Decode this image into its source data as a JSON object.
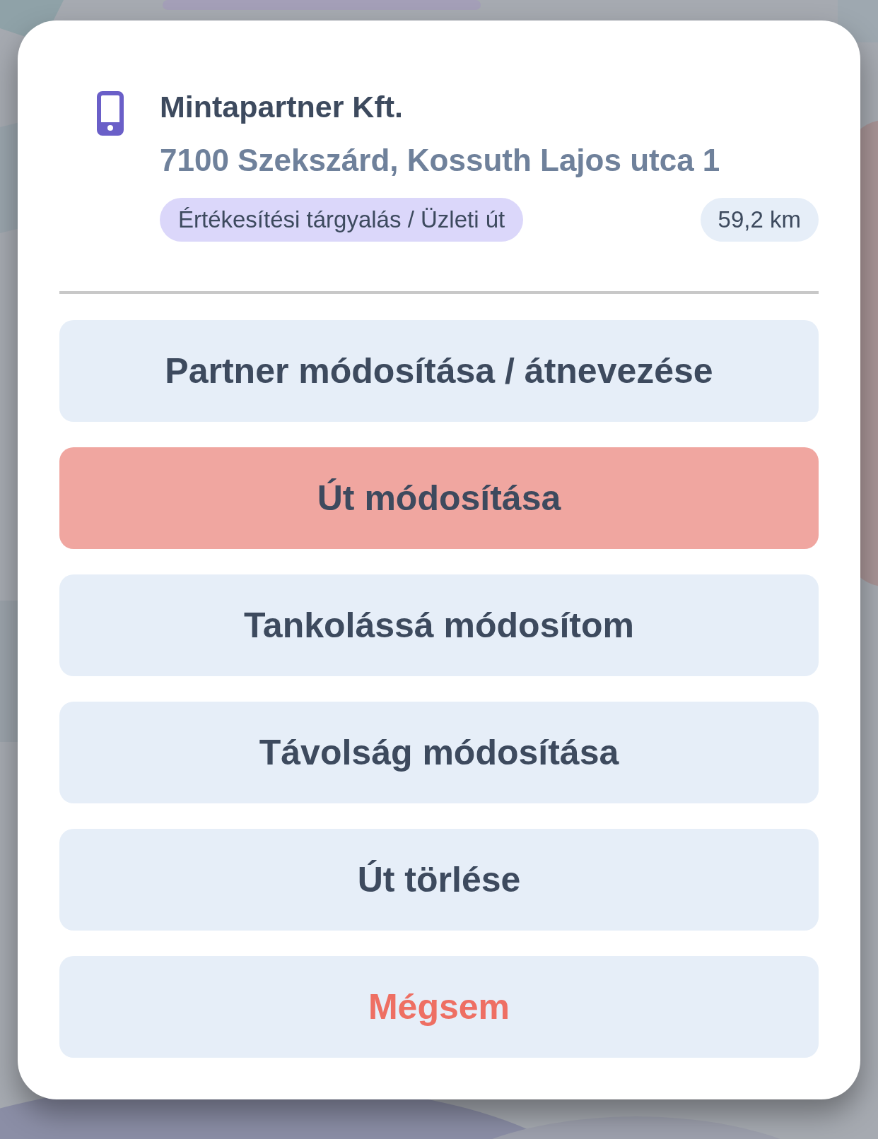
{
  "partner": {
    "name": "Mintapartner Kft.",
    "address": "7100 Szekszárd, Kossuth Lajos utca 1",
    "category": "Értékesítési tárgyalás / Üzleti út",
    "distance": "59,2 km"
  },
  "actions": [
    {
      "label": "Partner módosítása / átnevezése",
      "kind": "default"
    },
    {
      "label": "Út módosítása",
      "kind": "highlighted"
    },
    {
      "label": "Tankolássá módosítom",
      "kind": "default"
    },
    {
      "label": "Távolság módosítása",
      "kind": "default"
    },
    {
      "label": "Út törlése",
      "kind": "default"
    },
    {
      "label": "Mégsem",
      "kind": "cancel"
    }
  ]
}
